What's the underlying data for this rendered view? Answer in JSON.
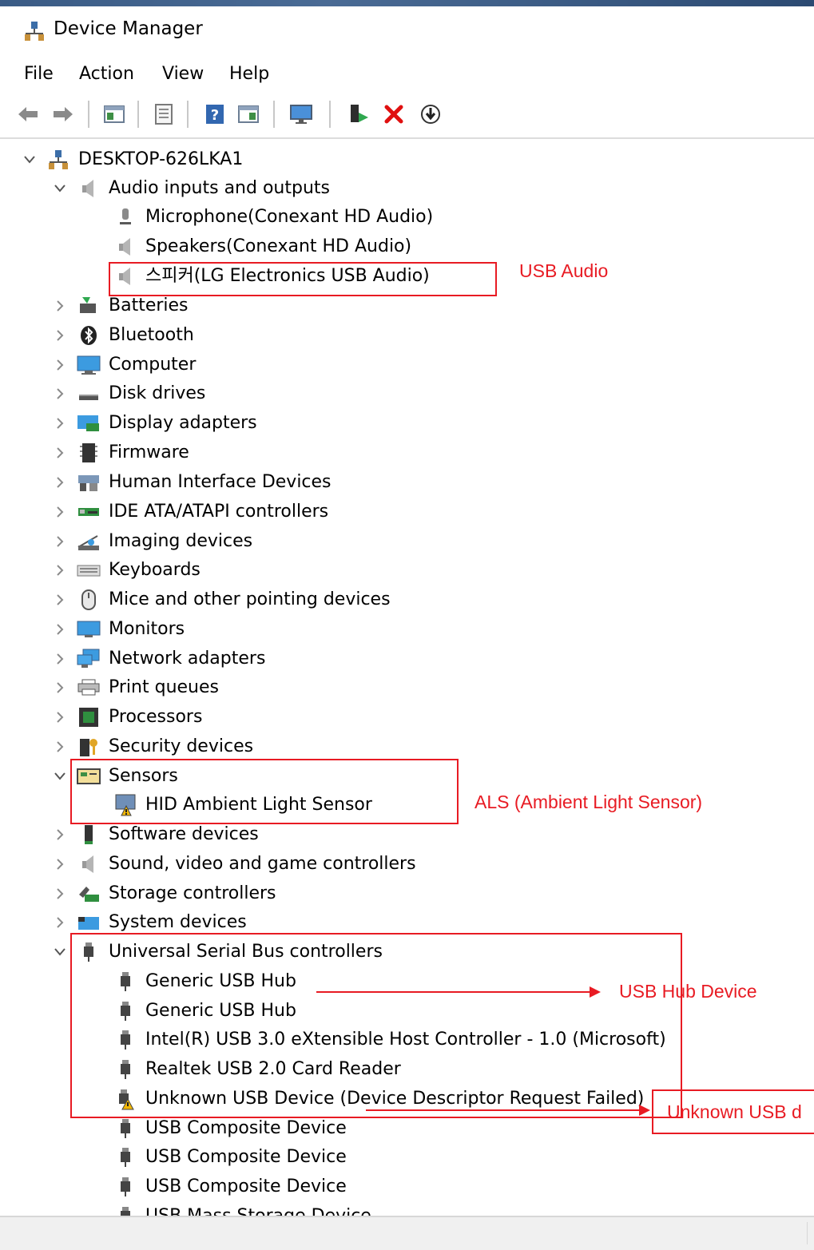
{
  "window": {
    "title": "Device Manager"
  },
  "menu": [
    "File",
    "Action",
    "View",
    "Help"
  ],
  "toolbar": [
    "back-icon",
    "forward-icon",
    "show-hide-tree-icon",
    "properties-icon",
    "help-icon",
    "view-icon",
    "monitor-icon",
    "update-driver-icon",
    "uninstall-icon",
    "disable-device-icon"
  ],
  "tree": {
    "root": "DESKTOP-626LKA1",
    "audio": {
      "label": "Audio inputs and outputs",
      "children": [
        "Microphone(Conexant HD Audio)",
        "Speakers(Conexant HD Audio)",
        "스피커(LG Electronics USB Audio)"
      ]
    },
    "categories_a": [
      "Batteries",
      "Bluetooth",
      "Computer",
      "Disk drives",
      "Display adapters",
      "Firmware",
      "Human Interface Devices",
      "IDE ATA/ATAPI controllers",
      "Imaging devices",
      "Keyboards",
      "Mice and other pointing devices",
      "Monitors",
      "Network adapters",
      "Print queues",
      "Processors",
      "Security devices"
    ],
    "sensors": {
      "label": "Sensors",
      "children": [
        "HID Ambient Light Sensor"
      ]
    },
    "categories_b": [
      "Software devices",
      "Sound, video and game controllers",
      "Storage controllers",
      "System devices"
    ],
    "usb": {
      "label": "Universal Serial Bus controllers",
      "children": [
        "Generic USB Hub",
        "Generic USB Hub",
        "Intel(R) USB 3.0 eXtensible Host Controller - 1.0 (Microsoft)",
        "Realtek USB 2.0 Card Reader",
        "Unknown USB Device (Device Descriptor Request Failed)",
        "USB Composite Device",
        "USB Composite Device",
        "USB Composite Device",
        "USB Mass Storage Device"
      ]
    }
  },
  "annotations": {
    "usb_audio": "USB Audio",
    "als": "ALS (Ambient Light Sensor)",
    "usb_hub": "USB Hub Device",
    "unknown_usb": "Unknown USB d"
  },
  "colors": {
    "annotation": "#e81b23",
    "warning": "#f2b705"
  }
}
